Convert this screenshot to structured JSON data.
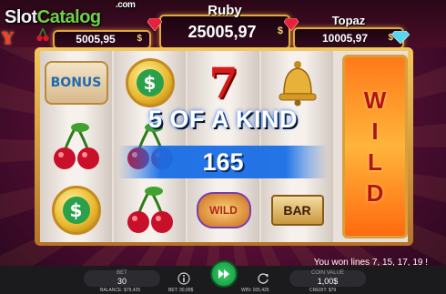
{
  "watermark": {
    "slot": "Slot",
    "catalog": "Catalog",
    "com": ".com"
  },
  "game_logo": "Y",
  "jackpots": [
    {
      "name": "",
      "value": "5005,95",
      "currency": "$"
    },
    {
      "name": "Ruby",
      "value": "25005,97",
      "currency": "$"
    },
    {
      "name": "Topaz",
      "value": "10005,97",
      "currency": "$"
    }
  ],
  "reels": {
    "reel1": [
      "BONUS",
      "cherries",
      "$"
    ],
    "reel2": [
      "$",
      "cherries",
      "cherries"
    ],
    "reel3": [
      "7",
      "",
      "WILD"
    ],
    "reel4": [
      "bell",
      "",
      "BAR"
    ],
    "reel5_wild": [
      "W",
      "I",
      "L",
      "D"
    ]
  },
  "win": {
    "title": "5 OF A KIND",
    "amount": "165"
  },
  "status_message": "You won lines 7, 15, 17, 19 !",
  "controls": {
    "bet_label": "BET",
    "bet_value": "30",
    "coin_value_label": "COIN VALUE",
    "coin_value": "1,00$"
  },
  "footer": {
    "balance_label": "BALANCE:",
    "balance_value": "$79,425",
    "bet_label": "BET:",
    "bet_value": "30,00$",
    "win_label": "WIN:",
    "win_value": "165,425",
    "credit_label": "CREDIT:",
    "credit_value": "$79"
  },
  "colors": {
    "frame_gold": "#e0a93a",
    "spin_green": "#22b04e",
    "wild_orange": "#ff8a20"
  },
  "icons": [
    "cherry-icon",
    "gem-icon",
    "info-icon",
    "spin-icon",
    "autoplay-icon"
  ]
}
